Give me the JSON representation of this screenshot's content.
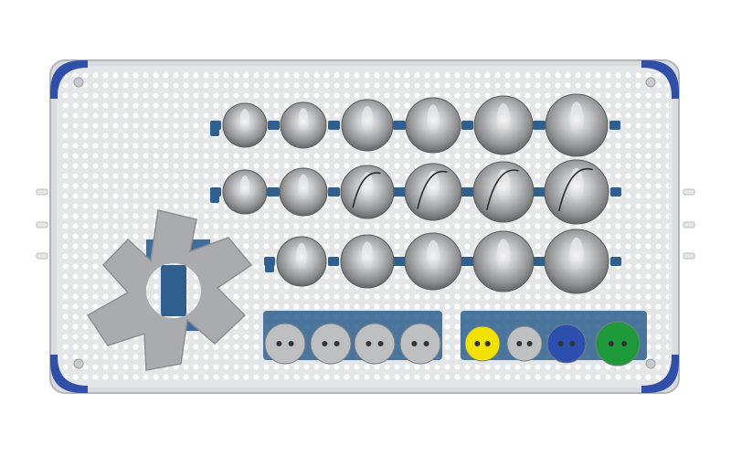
{
  "scene": {
    "subject": "surgical-instrument-tray",
    "colors": {
      "background": "#ffffff",
      "tray": "#e4e6e8",
      "tray_border": "#b9bcc0",
      "perforation": "#ffffff",
      "corner_bumper": "#2f4fa8",
      "holder_blue": "#2e5f8e",
      "ball_dark": "#6f7173",
      "ball_light": "#e6e7e8",
      "hex_key": "#a9abae",
      "disc_gray": "#bdbfc1",
      "disc_yellow": "#f2e200",
      "disc_blue": "#2d4fb0",
      "disc_green": "#1f9a3a"
    }
  },
  "instruments": {
    "ball_rows": [
      {
        "row": 1,
        "count": 6
      },
      {
        "row": 2,
        "count": 6
      },
      {
        "row": 3,
        "count": 5
      }
    ],
    "disc_row": [
      {
        "color": "disc_gray"
      },
      {
        "color": "disc_gray"
      },
      {
        "color": "disc_gray"
      },
      {
        "color": "disc_gray"
      },
      {
        "color": "disc_yellow"
      },
      {
        "color": "disc_gray"
      },
      {
        "color": "disc_blue"
      },
      {
        "color": "disc_green"
      }
    ],
    "tool": "hex-wrench",
    "handles": [
      "left-handle",
      "right-handle"
    ],
    "corner_bumpers": 4
  }
}
